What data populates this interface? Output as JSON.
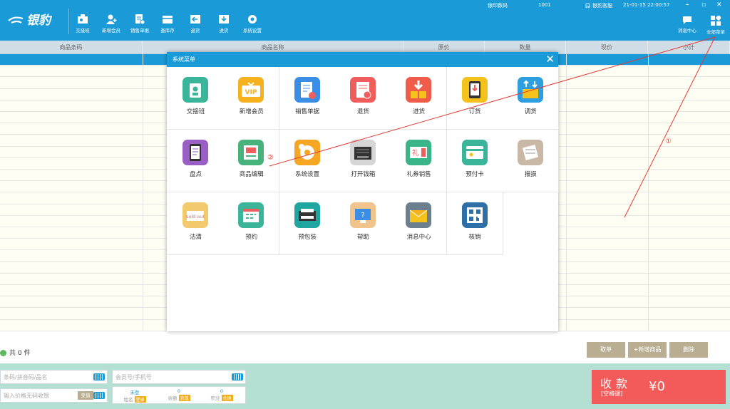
{
  "app": {
    "logo": "银豹"
  },
  "toolbar": {
    "items": [
      {
        "label": "交接班",
        "icon": "handover-icon"
      },
      {
        "label": "新增会员",
        "icon": "add-member-icon"
      },
      {
        "label": "销售单据",
        "icon": "sales-receipt-icon"
      },
      {
        "label": "查库存",
        "icon": "inventory-icon"
      },
      {
        "label": "退货",
        "icon": "return-icon"
      },
      {
        "label": "进货",
        "icon": "purchase-icon"
      },
      {
        "label": "系统设置",
        "icon": "settings-icon"
      }
    ],
    "message_center": "消息中心",
    "all_menu": "全部菜单"
  },
  "window_info": {
    "store": "银印数码",
    "cashier": "1001",
    "service": "银豹客服",
    "datetime": "21-01-15 22:00:57"
  },
  "table": {
    "headers": [
      "商品条码",
      "商品名称",
      "原价",
      "数量",
      "现价",
      "小计"
    ]
  },
  "summary": {
    "count_label": "共 0 件"
  },
  "actions": {
    "take": "取单",
    "add_product": "+新增商品",
    "delete": "删除"
  },
  "inputs": {
    "barcode_placeholder": "条码/拼音码/品名",
    "price_placeholder": "输入价格无码收银",
    "price_mode": "变值",
    "member_placeholder": "会员号/手机号"
  },
  "member": {
    "name_value": "未登",
    "name_label": "姓名",
    "name_badge": "登录",
    "balance_value": "0",
    "balance_label": "余额",
    "balance_badge": "充值",
    "points_value": "0",
    "points_label": "积分",
    "points_badge": "兑换"
  },
  "pay": {
    "title": "收款",
    "shortcut": "[空格键]",
    "amount": "¥0"
  },
  "modal": {
    "title": "系统菜单",
    "items": [
      {
        "label": "交接班",
        "icon": "handover-icon",
        "color": "#3ab59a"
      },
      {
        "label": "新增会员",
        "icon": "vip-icon",
        "color": "#f5b21c"
      },
      {
        "label": "销售单据",
        "icon": "sales-receipt-icon",
        "color": "#3b8ee6"
      },
      {
        "label": "退货",
        "icon": "return-icon",
        "color": "#ef5d5d"
      },
      {
        "label": "进货",
        "icon": "purchase-icon",
        "color": "#ef5d4a"
      },
      {
        "label": "订货",
        "icon": "order-icon",
        "color": "#f5c21c"
      },
      {
        "label": "调货",
        "icon": "transfer-icon",
        "color": "#2d9ee0"
      },
      {
        "label": "盘点",
        "icon": "stocktake-icon",
        "color": "#9a5fc4"
      },
      {
        "label": "商品编辑",
        "icon": "product-edit-icon",
        "color": "#46b37d"
      },
      {
        "label": "系统设置",
        "icon": "settings-icon",
        "color": "#f5a623"
      },
      {
        "label": "打开钱箱",
        "icon": "cash-drawer-icon",
        "color": "#d6d6d6"
      },
      {
        "label": "礼券销售",
        "icon": "coupon-icon",
        "color": "#3ab58a"
      },
      {
        "label": "预付卡",
        "icon": "prepaid-card-icon",
        "color": "#3ab59a"
      },
      {
        "label": "报损",
        "icon": "damage-icon",
        "color": "#c9b8a6"
      },
      {
        "label": "沽清",
        "icon": "sold-out-icon",
        "color": "#f3c96e"
      },
      {
        "label": "预约",
        "icon": "reservation-icon",
        "color": "#3ab59a"
      },
      {
        "label": "预包装",
        "icon": "prepack-icon",
        "color": "#1fa6a0"
      },
      {
        "label": "帮助",
        "icon": "help-icon",
        "color": "#f0c48a"
      },
      {
        "label": "消息中心",
        "icon": "message-icon",
        "color": "#6b7f8e"
      },
      {
        "label": "核销",
        "icon": "verify-qr-icon",
        "color": "#2d6fa6"
      }
    ],
    "sold_out_text": "sold out",
    "vip_text": "VIP"
  },
  "annotations": {
    "marker1": "①",
    "marker2": "②"
  },
  "colors": {
    "primary": "#1a9ad6",
    "pay": "#f25b59",
    "bottom": "#b3e0d3",
    "row": "#fefff2"
  }
}
